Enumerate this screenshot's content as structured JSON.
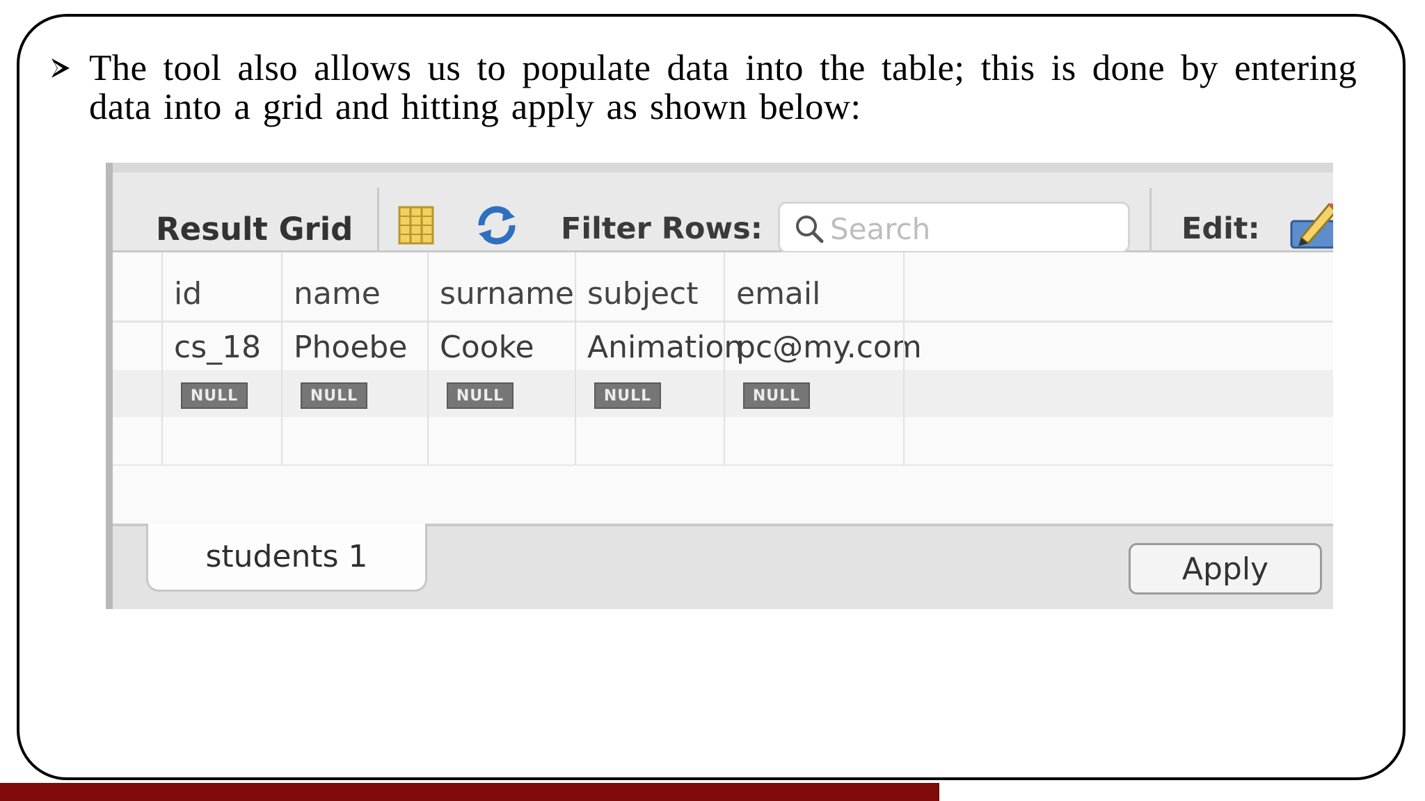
{
  "slide": {
    "bullet_text": "The tool also allows us to populate data into the table; this is done by entering data into a grid and hitting apply as shown below:",
    "accent_color": "#7e0a0a"
  },
  "toolbar": {
    "title": "Result Grid",
    "filter_label": "Filter Rows:",
    "search_placeholder": "Search",
    "edit_label": "Edit:"
  },
  "table": {
    "columns": [
      "id",
      "name",
      "surname",
      "subject",
      "email"
    ],
    "rows": [
      [
        "cs_18",
        "Phoebe",
        "Cooke",
        "Animation",
        "pc@my.com"
      ],
      [
        "NULL",
        "NULL",
        "NULL",
        "NULL",
        "NULL"
      ]
    ]
  },
  "footer": {
    "tab_label": "students 1",
    "apply_label": "Apply"
  },
  "icons": {
    "bullet": "arrowhead-bullet-icon",
    "grid": "grid-icon",
    "refresh": "refresh-icon",
    "search": "search-icon",
    "edit": "pencil-icon"
  }
}
